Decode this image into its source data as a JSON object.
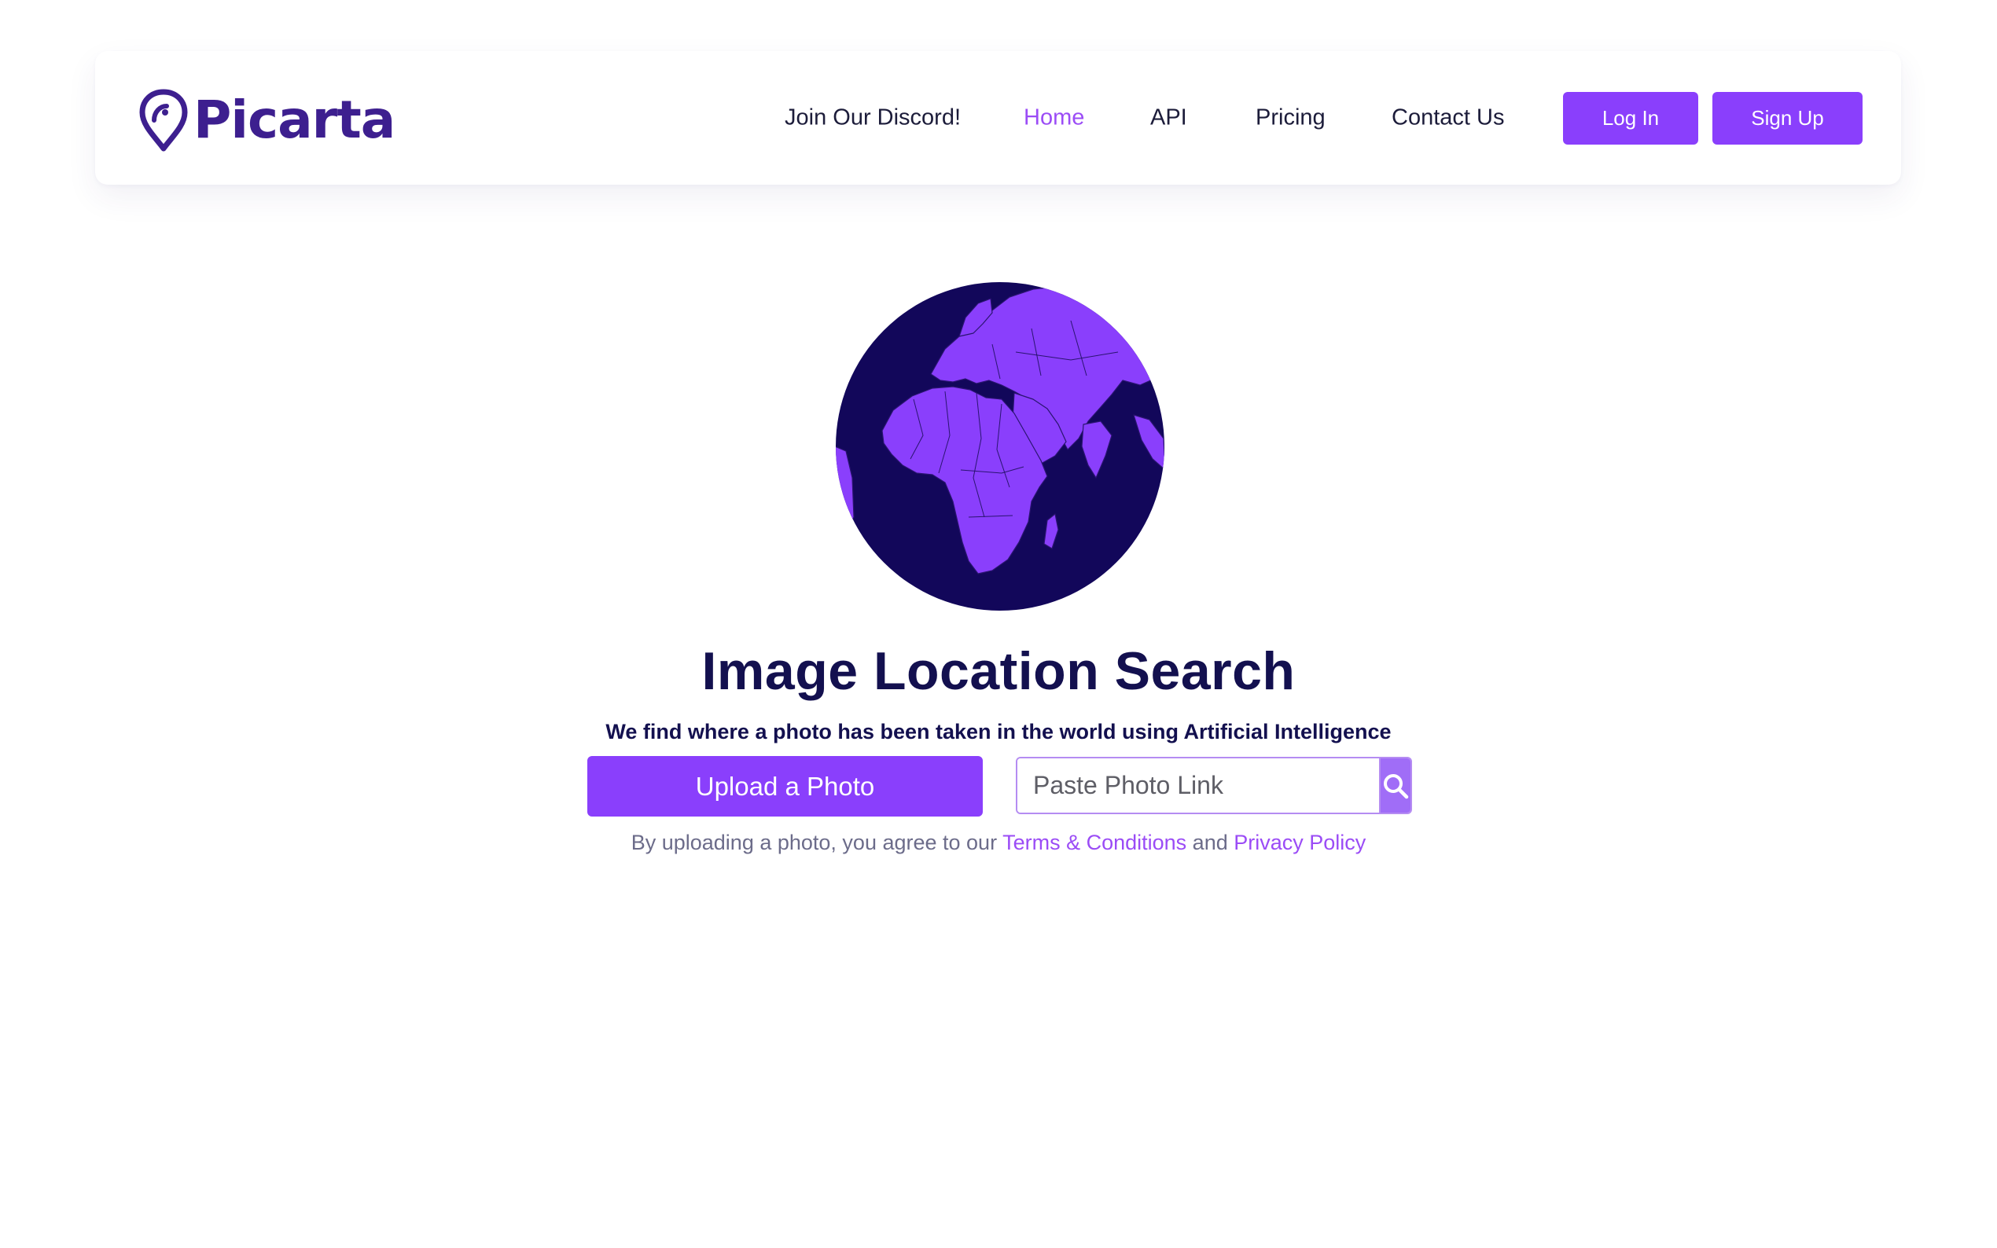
{
  "brand": {
    "name": "Picarta",
    "primary_color": "#8a3ffc",
    "dark_color": "#13104f"
  },
  "nav": {
    "items": [
      {
        "label": "Join Our Discord!",
        "active": false
      },
      {
        "label": "Home",
        "active": true
      },
      {
        "label": "API",
        "active": false
      },
      {
        "label": "Pricing",
        "active": false
      },
      {
        "label": "Contact Us",
        "active": false
      }
    ],
    "login_label": "Log In",
    "signup_label": "Sign Up"
  },
  "hero": {
    "title": "Image Location Search",
    "subtitle": "We find where a photo has been taken in the world using Artificial Intelligence",
    "upload_label": "Upload a Photo",
    "link_placeholder": "Paste Photo Link",
    "search_icon": "search-icon",
    "globe_icon": "globe-icon"
  },
  "legal": {
    "prefix": "By uploading a photo, you agree to our ",
    "terms_label": "Terms & Conditions",
    "middle": " and ",
    "privacy_label": "Privacy Policy"
  }
}
